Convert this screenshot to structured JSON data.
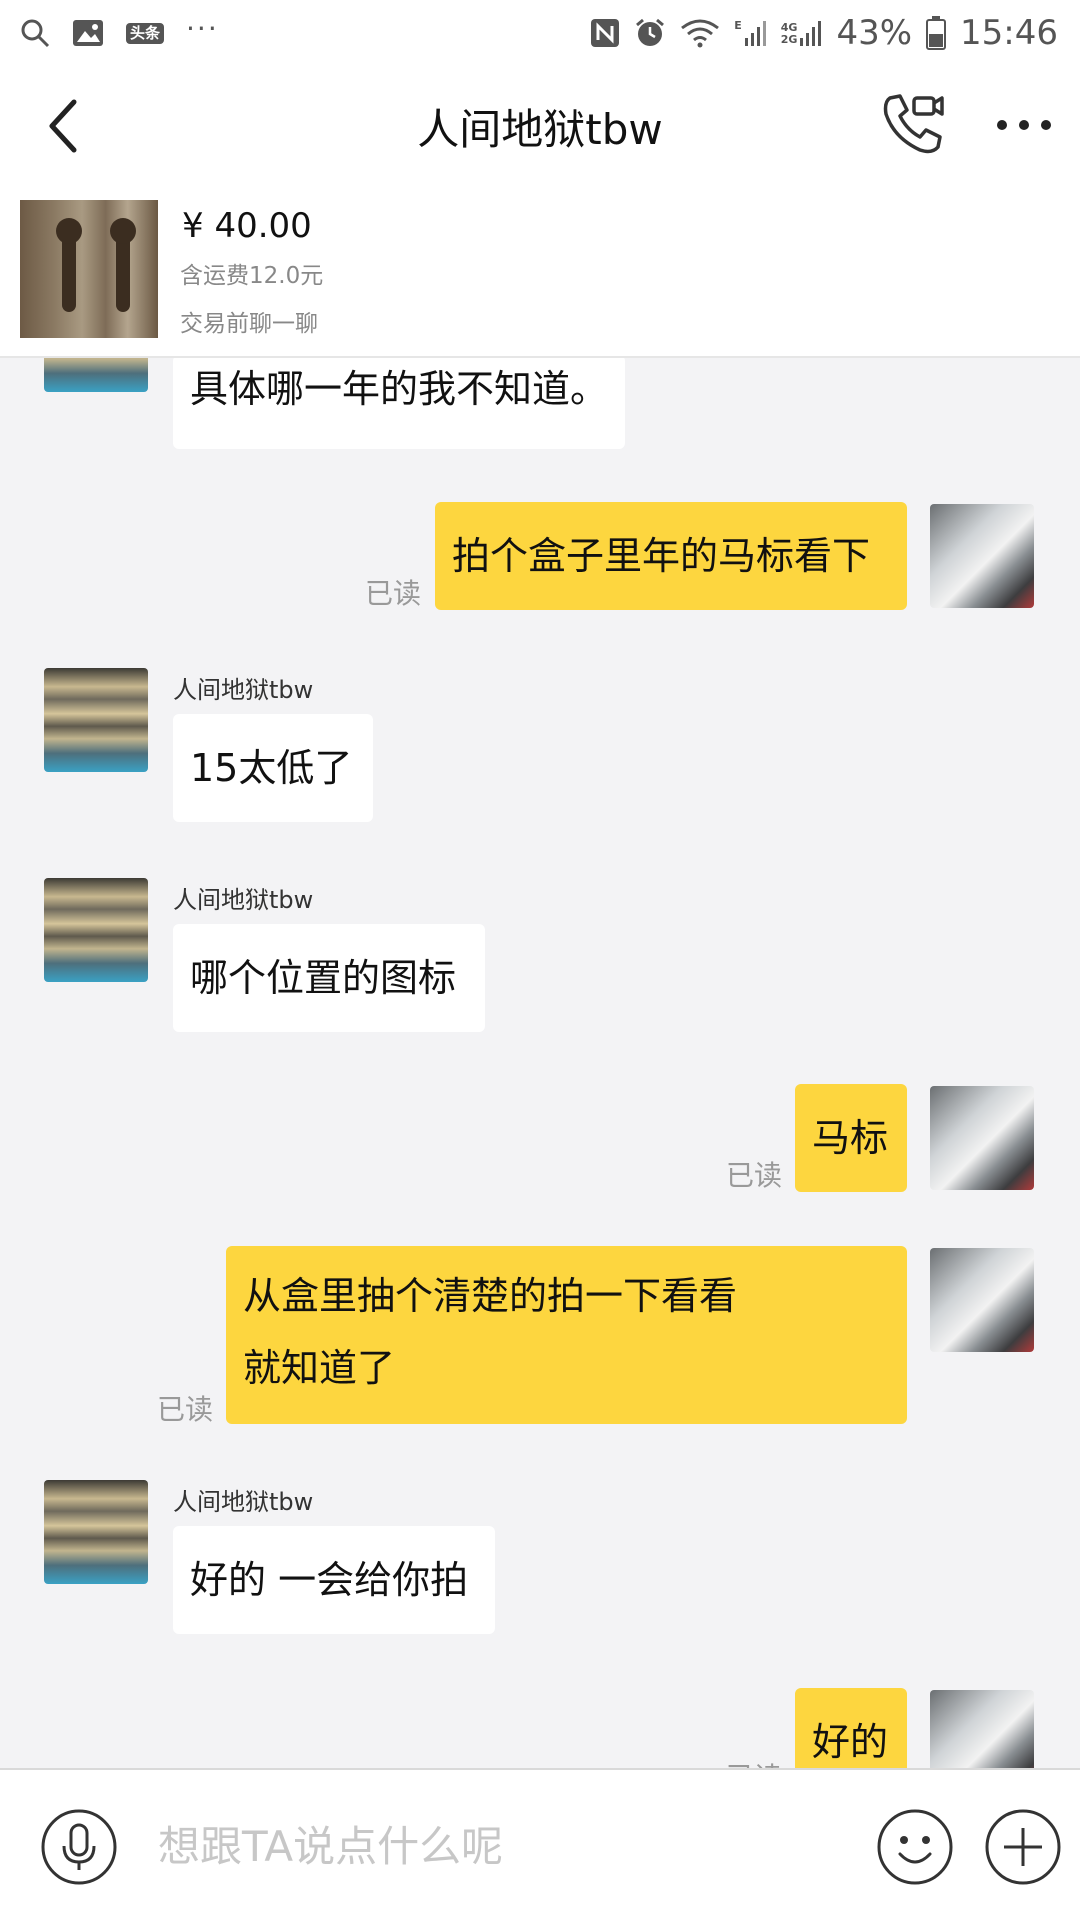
{
  "status_bar": {
    "left_icons": [
      "search-icon",
      "image-icon",
      "toutiao-icon",
      "more-notifications-icon"
    ],
    "toutiao_label": "头条",
    "right_icons": [
      "nfc-icon",
      "alarm-icon",
      "wifi-icon",
      "signal-icon"
    ],
    "network_e": "E",
    "network_4g": "4G",
    "network_2g": "2G",
    "battery": "43%",
    "time": "15:46"
  },
  "nav": {
    "title": "人间地狱tbw",
    "icons": [
      "back-icon",
      "call-video-icon",
      "more-icon"
    ]
  },
  "product": {
    "price": "¥ 40.00",
    "shipping": "含运费12.0元",
    "status": "交易前聊一聊"
  },
  "messages": [
    {
      "side": "in",
      "text": "具体哪一年的我不知道。"
    },
    {
      "side": "out",
      "text": "拍个盒子里年的马标看下",
      "read": "已读"
    },
    {
      "side": "in",
      "sender": "人间地狱tbw",
      "text": "15太低了"
    },
    {
      "side": "in",
      "sender": "人间地狱tbw",
      "text": "哪个位置的图标"
    },
    {
      "side": "out",
      "text": "马标",
      "read": "已读"
    },
    {
      "side": "out",
      "text_line1": "从盒里抽个清楚的拍一下看看",
      "text_line2": "就知道了",
      "read": "已读"
    },
    {
      "side": "in",
      "sender": "人间地狱tbw",
      "text": "好的 一会给你拍"
    },
    {
      "side": "out",
      "text": "好的",
      "read": "已读"
    }
  ],
  "input": {
    "placeholder": "想跟TA说点什么呢",
    "icons": [
      "voice-icon",
      "emoji-icon",
      "plus-icon"
    ]
  },
  "colors": {
    "bubble_out": "#fdd63f",
    "bubble_in": "#ffffff",
    "chat_bg": "#f3f3f5"
  }
}
